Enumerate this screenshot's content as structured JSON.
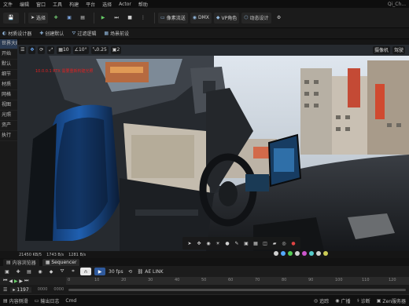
{
  "menubar": {
    "items": [
      "文件",
      "编辑",
      "窗口",
      "工具",
      "构建",
      "平台",
      "选择",
      "Actor",
      "帮助"
    ],
    "project": "Qi_Ch..."
  },
  "toolbar": {
    "select_mode": "选择",
    "play_icons": [
      "play-icon",
      "step-icon",
      "stop-icon"
    ],
    "render_label": "像素流送",
    "preset_label": "DMX",
    "vp_label": "VP角色",
    "dynamic_label": "动态设计"
  },
  "subtoolbar": {
    "items": [
      "材质设计器",
      "创建默认",
      "过滤逻辑",
      "场景前设"
    ]
  },
  "left_panel": {
    "items": [
      "世界大纲",
      "开始",
      "默认",
      "细节",
      "材质",
      "网格",
      "视图",
      "光照",
      "资产",
      "执行"
    ]
  },
  "viewport_toolbar": {
    "grid_value": "10",
    "angle_value": "10°",
    "scale_value": "0.25",
    "camera_value": "2",
    "view_mode": "摄像机",
    "pilot": "驾驶"
  },
  "viewport_overlay": {
    "warning": "10.0.0.1 RTX 需要重新构建光照"
  },
  "viewport_bottom": {
    "tools": [
      "select-icon",
      "move-icon",
      "camera-icon",
      "light-icon",
      "sphere-icon",
      "paint-icon",
      "render-icon",
      "grid-icon",
      "box-icon",
      "car-icon",
      "eye-icon",
      "record-icon"
    ]
  },
  "stats": {
    "tris": "21450 KB/5",
    "draws": "1743 B/s",
    "mem": "1281 B/s"
  },
  "sequencer": {
    "tabs": [
      "内容浏览器",
      "Sequencer"
    ],
    "fps": "30 fps",
    "link_label": "AE LINK"
  },
  "timeline": {
    "ticks": [
      "0",
      "10",
      "20",
      "30",
      "40",
      "50",
      "60",
      "70",
      "80",
      "90",
      "100",
      "110",
      "120"
    ]
  },
  "transport": {
    "frame": "1197",
    "start": "0000",
    "end": "0000"
  },
  "statusbar": {
    "cmd": "Cmd",
    "content_drawer": "内容侧滑",
    "output_log": "输出日志",
    "right_items": [
      "追踪",
      "广播",
      "诊断",
      "Zen服务器"
    ]
  }
}
